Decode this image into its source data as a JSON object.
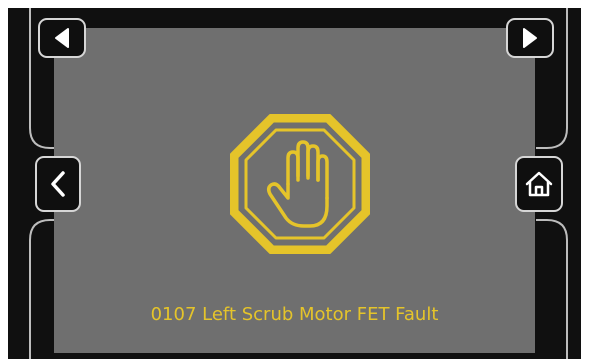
{
  "navigation": {
    "prev_icon": "triangle-left-icon",
    "next_icon": "triangle-right-icon",
    "back_icon": "chevron-left-icon",
    "home_icon": "home-icon"
  },
  "fault": {
    "icon": "stop-hand-icon",
    "message": "0107 Left Scrub Motor FET Fault"
  },
  "colors": {
    "bezel": "#101010",
    "screen": "#6f6f6f",
    "accent": "#e5c42a",
    "button_border": "#d6d6d6"
  }
}
